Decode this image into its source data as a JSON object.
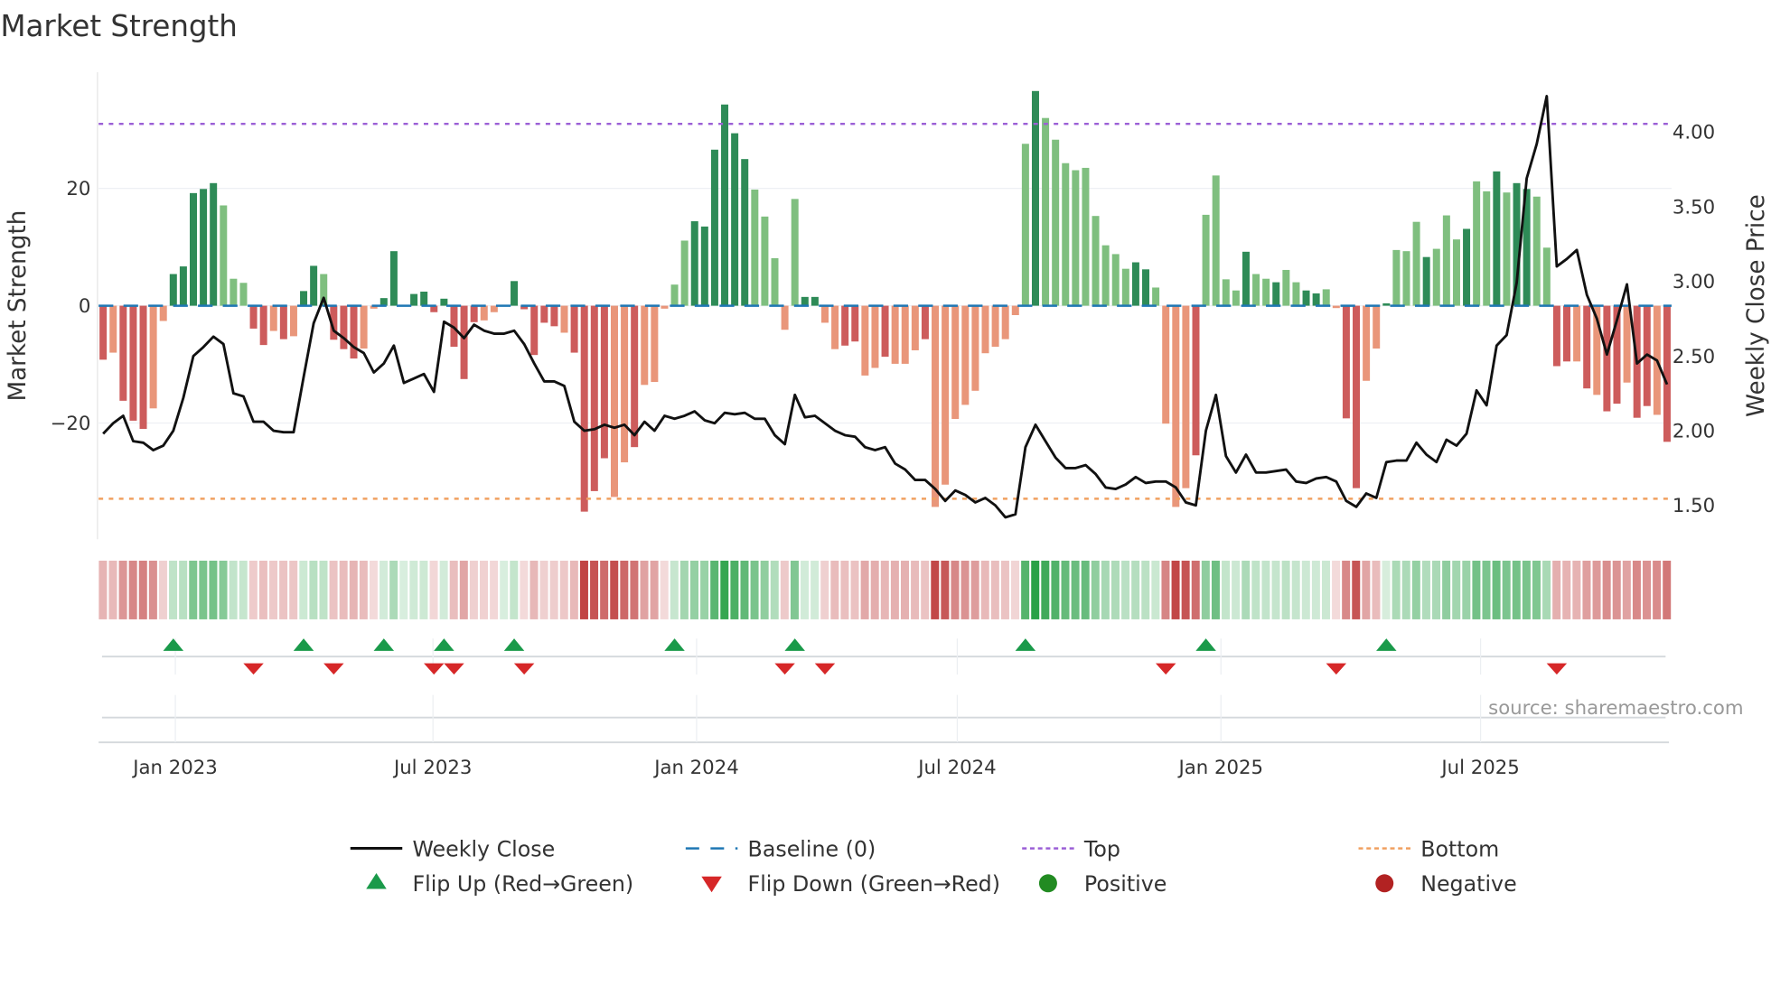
{
  "title": "Market Strength",
  "source": "source: sharemaestro.com",
  "colors": {
    "pos_strong": "#2e8b57",
    "pos_weak": "#7fbf7f",
    "neg_strong": "#cd5c5c",
    "neg_weak": "#e9967a",
    "close": "#111111",
    "baseline": "#1f77b4",
    "top": "#9b5fd6",
    "bottom": "#f0a060",
    "flip_up": "#1a9a4a",
    "flip_down": "#d62728",
    "positive": "#228b22",
    "negative": "#b22222"
  },
  "legend": [
    {
      "key": "close",
      "label": "Weekly Close"
    },
    {
      "key": "baseline",
      "label": "Baseline (0)"
    },
    {
      "key": "top",
      "label": "Top"
    },
    {
      "key": "bottom",
      "label": "Bottom"
    },
    {
      "key": "flip_up",
      "label": "Flip Up (Red→Green)"
    },
    {
      "key": "flip_down",
      "label": "Flip Down (Green→Red)"
    },
    {
      "key": "positive",
      "label": "Positive"
    },
    {
      "key": "negative",
      "label": "Negative"
    }
  ],
  "chart_data": {
    "type": "bar",
    "title": "Market Strength",
    "ylabel": "Market Strength",
    "y2label": "Weekly Close Price",
    "ylim": [
      -38,
      39
    ],
    "y2lim": [
      1.32,
      4.35
    ],
    "yticks": [
      {
        "v": 20,
        "label": "20"
      },
      {
        "v": 0,
        "label": "0"
      },
      {
        "v": -20,
        "label": "−20"
      }
    ],
    "y2ticks": [
      {
        "v": 4.0,
        "label": "4.00"
      },
      {
        "v": 3.5,
        "label": "3.50"
      },
      {
        "v": 3.0,
        "label": "3.00"
      },
      {
        "v": 2.5,
        "label": "2.50"
      },
      {
        "v": 2.0,
        "label": "2.00"
      },
      {
        "v": 1.5,
        "label": "1.50"
      }
    ],
    "xticks": [
      {
        "week": 7.2,
        "label": "Jan 2023"
      },
      {
        "week": 32.9,
        "label": "Jul 2023"
      },
      {
        "week": 59.2,
        "label": "Jan 2024"
      },
      {
        "week": 85.2,
        "label": "Jul 2024"
      },
      {
        "week": 111.5,
        "label": "Jan 2025"
      },
      {
        "week": 137.4,
        "label": "Jul 2025"
      }
    ],
    "top_level": 31,
    "bottom_level": -32.9,
    "strength": [
      -9.2,
      -8.0,
      -16.2,
      -19.6,
      -21,
      -17.5,
      -2.6,
      5.4,
      6.7,
      19.2,
      19.9,
      20.9,
      17.1,
      4.6,
      3.9,
      -3.9,
      -6.7,
      -4.3,
      -5.7,
      -5.2,
      2.5,
      6.8,
      5.4,
      -5.8,
      -7.4,
      -9,
      -7.3,
      -0.5,
      1.3,
      9.3,
      0,
      2.0,
      2.4,
      -1.1,
      1.2,
      -7,
      -12.5,
      -2.8,
      -2.5,
      -1.1,
      0,
      4.2,
      -0.6,
      -8.4,
      -2.9,
      -3.5,
      -4.6,
      -8,
      -35.1,
      -31.6,
      -26,
      -32.6,
      -26.7,
      -24.1,
      -13.5,
      -13,
      -0.5,
      3.6,
      11.1,
      14.4,
      13.5,
      26.6,
      34.3,
      29.4,
      25,
      19.8,
      15.2,
      8.1,
      -4.1,
      18.2,
      1.5,
      1.5,
      -2.9,
      -7.4,
      -6.8,
      -6.1,
      -11.9,
      -10.6,
      -8.7,
      -9.9,
      -9.9,
      -7.6,
      -5.7,
      -34.3,
      -30.5,
      -19.3,
      -16.9,
      -14.5,
      -8.1,
      -7,
      -5.7,
      -1.6,
      27.6,
      36.6,
      32,
      28.3,
      24.3,
      23.1,
      23.5,
      15.3,
      10.3,
      8.8,
      6.3,
      7.4,
      6.2,
      3.1,
      -20.1,
      -34.3,
      -31.1,
      -25.5,
      15.5,
      22.2,
      4.5,
      2.6,
      9.2,
      5.4,
      4.6,
      4.0,
      6.1,
      4.0,
      2.6,
      2.1,
      2.8,
      -0.4,
      -19.2,
      -31.1,
      -12.8,
      -7.3,
      0.4,
      9.5,
      9.3,
      14.3,
      8.3,
      9.7,
      15.4,
      11.3,
      13.1,
      21.2,
      19.5,
      22.9,
      19.3,
      20.9,
      19.9,
      18.6,
      9.9,
      -10.3,
      -9.5,
      -9.5,
      -14.1,
      -15.2,
      -18,
      -16.7,
      -13.1,
      -19.1,
      -17.1,
      -18.6,
      -23.2
    ],
    "shade": "dldddlldddddlllddldlddldddllddddddddddllldddddlddddlldlllllddddddlllllddllddlldllldlllllllllldlllllllllddlllldlllldlldllddllddlldllldllldlldlddllddldlddlddldldllldlldddlldldd",
    "close": [
      1.98,
      2.05,
      2.1,
      1.93,
      1.92,
      1.87,
      1.9,
      2.0,
      2.22,
      2.5,
      2.56,
      2.63,
      2.58,
      2.25,
      2.23,
      2.06,
      2.06,
      2.0,
      1.99,
      1.99,
      2.36,
      2.72,
      2.89,
      2.67,
      2.62,
      2.56,
      2.52,
      2.39,
      2.45,
      2.57,
      2.32,
      2.35,
      2.38,
      2.26,
      2.73,
      2.69,
      2.62,
      2.71,
      2.67,
      2.65,
      2.65,
      2.67,
      2.58,
      2.45,
      2.33,
      2.33,
      2.3,
      2.06,
      2.0,
      2.01,
      2.04,
      2.02,
      2.04,
      1.97,
      2.06,
      2.0,
      2.1,
      2.08,
      2.1,
      2.13,
      2.07,
      2.05,
      2.12,
      2.11,
      2.12,
      2.08,
      2.08,
      1.97,
      1.91,
      2.24,
      2.09,
      2.1,
      2.05,
      2.0,
      1.97,
      1.96,
      1.89,
      1.87,
      1.89,
      1.78,
      1.74,
      1.67,
      1.67,
      1.61,
      1.53,
      1.6,
      1.57,
      1.52,
      1.55,
      1.5,
      1.42,
      1.44,
      1.89,
      2.04,
      1.93,
      1.82,
      1.75,
      1.75,
      1.77,
      1.71,
      1.62,
      1.61,
      1.64,
      1.69,
      1.65,
      1.66,
      1.66,
      1.62,
      1.52,
      1.5,
      2.0,
      2.24,
      1.83,
      1.72,
      1.84,
      1.72,
      1.72,
      1.73,
      1.74,
      1.66,
      1.65,
      1.68,
      1.69,
      1.66,
      1.53,
      1.49,
      1.58,
      1.55,
      1.79,
      1.8,
      1.8,
      1.92,
      1.84,
      1.79,
      1.94,
      1.9,
      1.98,
      2.27,
      2.17,
      2.57,
      2.64,
      2.99,
      3.69,
      3.92,
      4.24,
      3.1,
      3.15,
      3.21,
      2.91,
      2.75,
      2.51,
      2.74,
      2.98,
      2.45,
      2.51,
      2.47,
      2.31
    ],
    "flips_up": [
      8,
      21,
      29,
      35,
      42,
      58,
      70,
      93,
      111,
      129
    ],
    "flips_down": [
      16,
      24,
      34,
      36,
      43,
      69,
      73,
      107,
      124,
      146
    ]
  }
}
